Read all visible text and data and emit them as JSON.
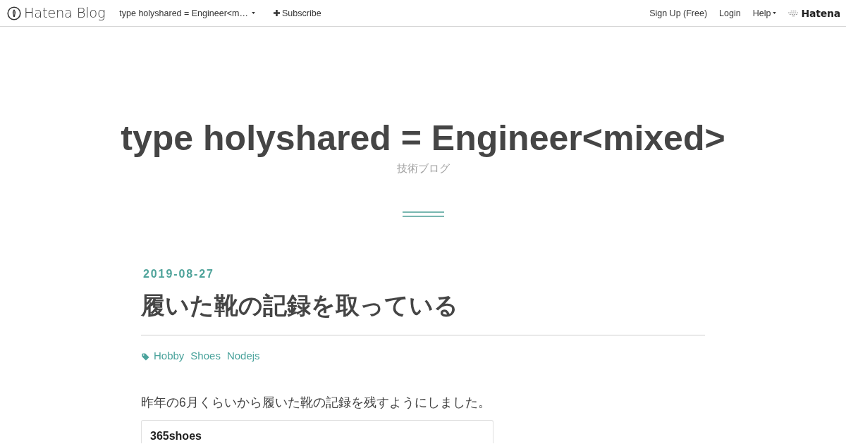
{
  "top_bar": {
    "brand": "Hatena Blog",
    "blog_menu": "type holyshared = Engineer<m…",
    "subscribe": "Subscribe",
    "links": [
      "Sign Up (Free)",
      "Login"
    ],
    "help": "Help",
    "hatena_logo": "Hatena"
  },
  "blog_header": {
    "title": "type holyshared = Engineer<mixed>",
    "description": "技術ブログ"
  },
  "entry": {
    "date": "2019-08-27",
    "title": "履いた靴の記録を取っている",
    "categories": [
      "Hobby",
      "Shoes",
      "Nodejs"
    ],
    "paragraph": "昨年の6月くらいから履いた靴の記録を残すようにしました。",
    "embed_card": {
      "title": "365shoes"
    }
  }
}
